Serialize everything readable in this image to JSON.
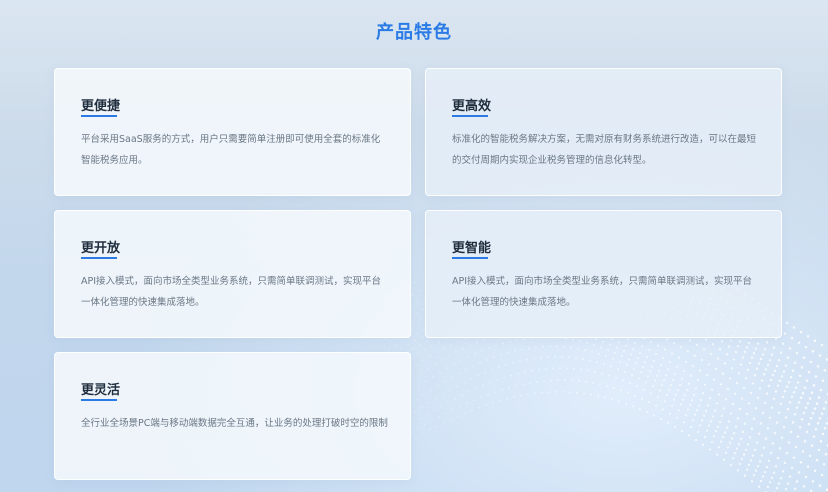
{
  "section": {
    "title": "产品特色"
  },
  "features": [
    {
      "title": "更便捷",
      "description": "平台采用SaaS服务的方式，用户只需要简单注册即可使用全套的标准化智能税务应用。"
    },
    {
      "title": "更高效",
      "description": "标准化的智能税务解决方案，无需对原有财务系统进行改造，可以在最短的交付周期内实现企业税务管理的信息化转型。"
    },
    {
      "title": "更开放",
      "description": "API接入模式，面向市场全类型业务系统，只需简单联调测试，实现平台一体化管理的快速集成落地。"
    },
    {
      "title": "更智能",
      "description": "API接入模式，面向市场全类型业务系统，只需简单联调测试，实现平台一体化管理的快速集成落地。"
    },
    {
      "title": "更灵活",
      "description": "全行业全场景PC端与移动端数据完全互通，让业务的处理打破时空的限制"
    }
  ],
  "colors": {
    "accent": "#2b7be6",
    "card_title": "#1f2d3d",
    "card_text": "#6b7785"
  }
}
